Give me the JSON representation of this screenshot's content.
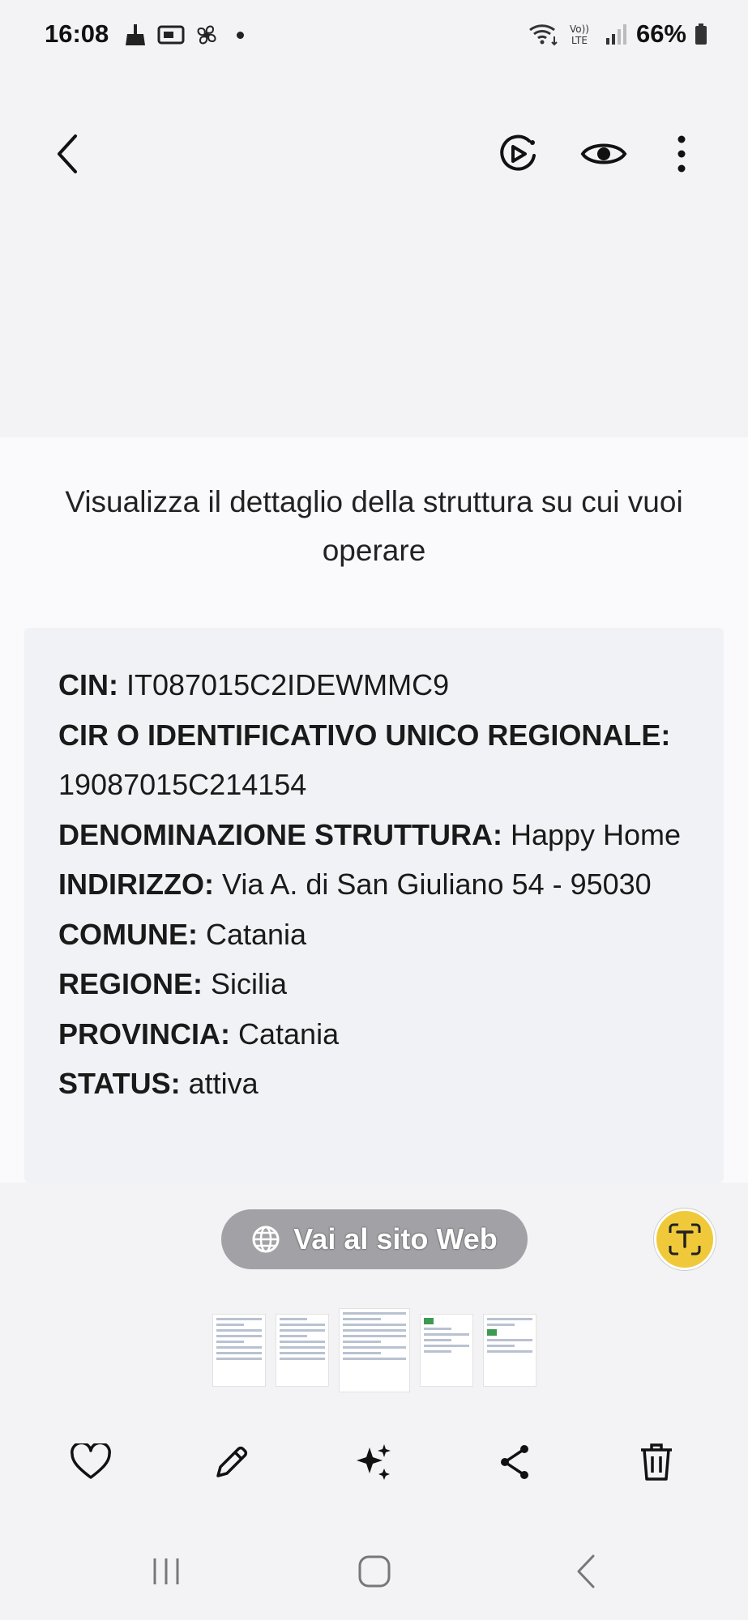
{
  "status_bar": {
    "time": "16:08",
    "battery": "66%",
    "left_icons": [
      "cleaner-icon",
      "cast-icon",
      "fan-icon"
    ],
    "right_icons": [
      "wifi-icon",
      "volte-icon",
      "signal-icon",
      "battery-icon"
    ]
  },
  "toolbar": {
    "icons": [
      "back-icon",
      "motion-play-icon",
      "eye-icon",
      "more-vertical-icon"
    ]
  },
  "content": {
    "heading": "Visualizza il dettaglio della struttura su cui vuoi operare",
    "fields": [
      {
        "label": "CIN:",
        "value": " IT087015C2IDEWMMC9"
      },
      {
        "label": "CIR O IDENTIFICATIVO UNICO REGIONALE:",
        "value": " 19087015C214154"
      },
      {
        "label": "DENOMINAZIONE STRUTTURA:",
        "value": " Happy Home"
      },
      {
        "label": "INDIRIZZO:",
        "value": " Via A. di San Giuliano 54 - 95030"
      },
      {
        "label": "COMUNE:",
        "value": " Catania"
      },
      {
        "label": "REGIONE:",
        "value": " Sicilia"
      },
      {
        "label": "PROVINCIA:",
        "value": " Catania"
      },
      {
        "label": "STATUS:",
        "value": " attiva"
      }
    ]
  },
  "overlay": {
    "web_button_label": "Vai al sito Web",
    "text_scan_icon": "text-extract-icon"
  },
  "colors": {
    "pill": "#a2a2a6",
    "text_scan": "#f0c93a",
    "background": "#f3f3f5"
  },
  "actions": [
    "heart-icon",
    "edit-icon",
    "sparkle-icon",
    "share-icon",
    "trash-icon"
  ],
  "navigation": [
    "recents-icon",
    "home-icon",
    "back-nav-icon"
  ]
}
